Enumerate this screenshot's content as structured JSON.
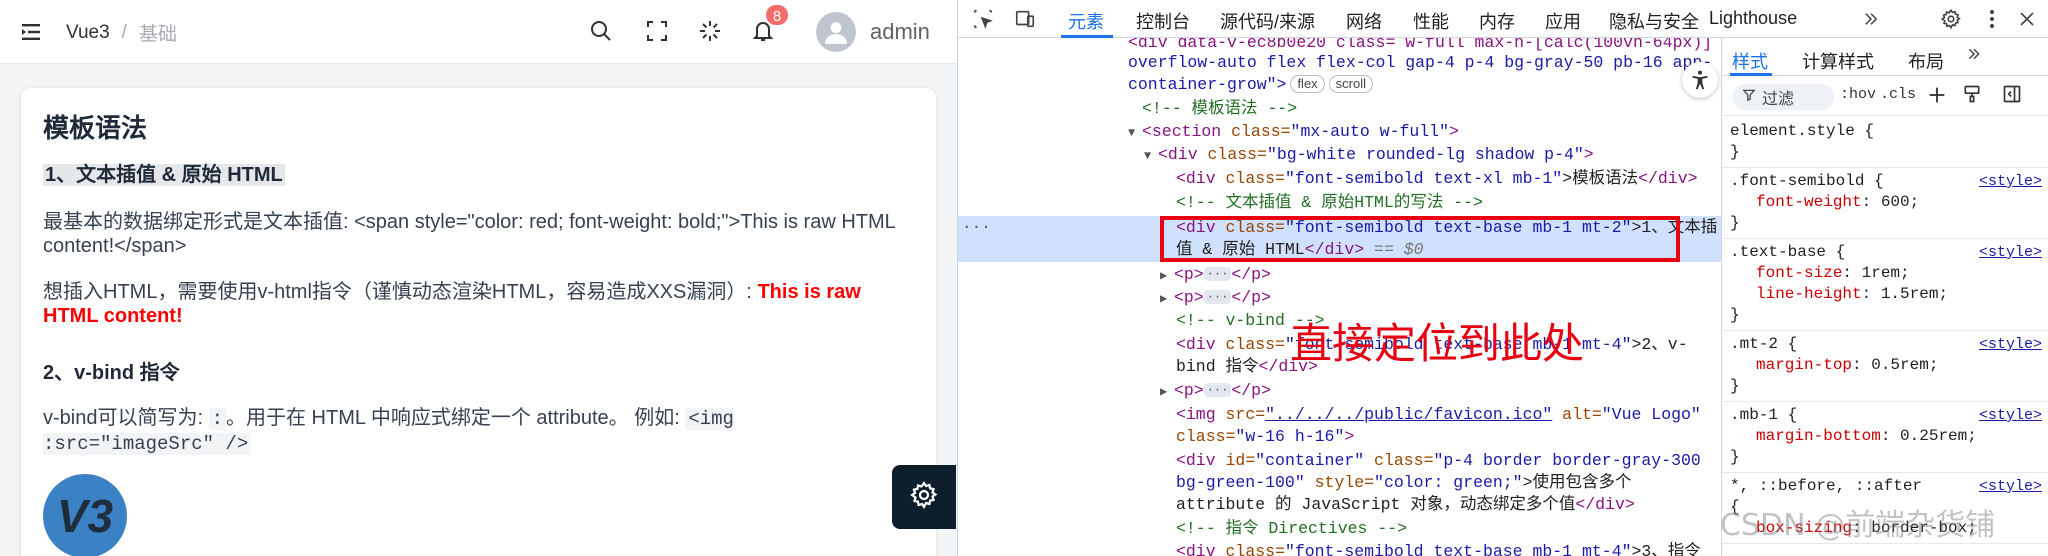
{
  "header": {
    "breadcrumb_root": "Vue3",
    "breadcrumb_sep": "/",
    "breadcrumb_current": "基础",
    "notification_count": "8",
    "username": "admin"
  },
  "card": {
    "title": "模板语法",
    "section1_title": "1、文本插值 & 原始 HTML",
    "p1": "最基本的数据绑定形式是文本插值: <span style=\"color: red; font-weight: bold;\">This is raw HTML content!</span>",
    "p2_prefix": "想插入HTML，需要使用v-html指令（谨慎动态渲染HTML，容易造成XXS漏洞）: ",
    "p2_red": "This is raw HTML content!",
    "section2_title": "2、v-bind 指令",
    "p3_prefix": "v-bind可以简写为: ",
    "p3_code1": ":",
    "p3_middle": "。用于在 HTML 中响应式绑定一个 attribute。 例如: ",
    "p3_code2": "<img :src=\"imageSrc\" />",
    "logo_text": "V3"
  },
  "devtools": {
    "tabs": [
      "元素",
      "控制台",
      "源代码/来源",
      "网络",
      "性能",
      "内存",
      "应用",
      "隐私与安全",
      "Lighthouse"
    ],
    "styles_tabs": [
      "样式",
      "计算样式",
      "布局"
    ],
    "filter_label": "过滤",
    "hov": ":hov",
    "cls": ".cls",
    "annotation": "直接定位到此处",
    "watermark": "CSDN @前端杂货铺"
  },
  "dom": {
    "l0_a": "<div data-v-ec8b0e20 class= w-full max-h-[calc(100vh-64px)]",
    "l1": "overflow-auto flex flex-col gap-4 p-4 bg-gray-50 pb-16 app-",
    "l2": "container-grow\">",
    "pill_flex": "flex",
    "pill_scroll": "scroll",
    "l3": "<!-- 模板语法 -->",
    "l4_tag": "<section ",
    "l4_attr": "class=",
    "l4_val": "\"mx-auto w-full\"",
    "l4_end": ">",
    "l5_tag": "<div ",
    "l5_attr": "class=",
    "l5_val": "\"bg-white rounded-lg shadow p-4\"",
    "l5_end": ">",
    "l6_tag": "<div ",
    "l6_attr": "class=",
    "l6_val": "\"font-semibold text-xl mb-1\"",
    "l6_text": ">模板语法",
    "l6_end": "</div>",
    "l7": "<!-- 文本插值 & 原始HTML的写法 -->",
    "l8_tag": "<div ",
    "l8_attr": "class=",
    "l8_val": "\"font-semibold text-base mb-1 mt-2\"",
    "l8_text": ">1、文本插",
    "l9_text": "值 & 原始 HTML",
    "l9_end": "</div>",
    "l9_eq": " == $0",
    "p_open": "<p>",
    "p_close": "</p>",
    "dots": "···",
    "l12": "<!-- v-bind -->",
    "l13_tag": "<div ",
    "l13_attr": "class=",
    "l13_val": "\"font-semibold text-base mb-1 mt-4\"",
    "l13_text": ">2、v-",
    "l14_text": "bind 指令",
    "l14_end": "</div>",
    "l16_tag": "<img ",
    "l16_attr1": "src=",
    "l16_val1": "\"../../../public/favicon.ico\"",
    "l16_attr2": " alt=",
    "l16_val2": "\"Vue Logo\"",
    "l17_attr": "class=",
    "l17_val": "\"w-16 h-16\"",
    "l17_end": ">",
    "l18_tag": "<div ",
    "l18_attr1": "id=",
    "l18_val1": "\"container\"",
    "l18_attr2": " class=",
    "l18_val2": "\"p-4 border border-gray-300",
    "l19_val": "bg-green-100\"",
    "l19_attr": " style=",
    "l19_val2": "\"color: green;\"",
    "l19_text": ">使用包含多个",
    "l20_text": "attribute 的 JavaScript 对象，动态绑定多个值",
    "l20_end": "</div>",
    "l21": "<!-- 指令 Directives -->",
    "l22_tag": "<div ",
    "l22_attr": "class=",
    "l22_val": "\"font-semibold text-base mb-1 mt-4\"",
    "l22_text": ">3、指令"
  },
  "styles": {
    "r0_sel": "element.style {",
    "r0_close": "}",
    "r1_sel": ".font-semibold {",
    "r1_src": "<style>",
    "r1_p1n": "font-weight",
    "r1_p1v": ": 600;",
    "r2_sel": ".text-base {",
    "r2_src": "<style>",
    "r2_p1n": "font-size",
    "r2_p1v": ": 1rem;",
    "r2_p2n": "line-height",
    "r2_p2v": ": 1.5rem;",
    "r3_sel": ".mt-2 {",
    "r3_src": "<style>",
    "r3_p1n": "margin-top",
    "r3_p1v": ": 0.5rem;",
    "r4_sel": ".mb-1 {",
    "r4_src": "<style>",
    "r4_p1n": "margin-bottom",
    "r4_p1v": ": 0.25rem;",
    "r5_sel": "*, ::before, ::after",
    "r5_src": "<style>",
    "r5_brace": "{",
    "r5_p1n": "box-sizing",
    "r5_p1v": ": border-box;",
    "close": "}"
  }
}
